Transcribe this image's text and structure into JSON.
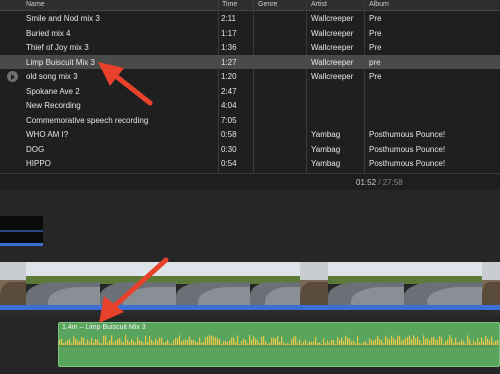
{
  "columns": {
    "name": "Name",
    "time": "Time",
    "genre": "Genre",
    "artist": "Artist",
    "album": "Album"
  },
  "songs": [
    {
      "name": "Smile and Nod mix 3",
      "time": "2:11",
      "artist": "Wallcreeper",
      "album": "Pre"
    },
    {
      "name": "Buried mix 4",
      "time": "1:17",
      "artist": "Wallcreeper",
      "album": "Pre"
    },
    {
      "name": "Thief of Joy mix 3",
      "time": "1:36",
      "artist": "Wallcreeper",
      "album": "Pre"
    },
    {
      "name": "Limp Buiscuit Mix 3",
      "time": "1:27",
      "artist": "Wallcreeper",
      "album": "pre"
    },
    {
      "name": "old song mix 3",
      "time": "1:20",
      "artist": "Wallcreeper",
      "album": "Pre"
    },
    {
      "name": "Spokane Ave 2",
      "time": "2:47",
      "artist": "",
      "album": ""
    },
    {
      "name": "New Recording",
      "time": "4:04",
      "artist": "",
      "album": ""
    },
    {
      "name": "Commemorative speech recording",
      "time": "7:05",
      "artist": "",
      "album": ""
    },
    {
      "name": "WHO AM I?",
      "time": "0:58",
      "artist": "Yambag",
      "album": "Posthumous Pounce!"
    },
    {
      "name": "DOG",
      "time": "0:30",
      "artist": "Yambag",
      "album": "Posthumous Pounce!"
    },
    {
      "name": "HIPPO",
      "time": "0:54",
      "artist": "Yambag",
      "album": "Posthumous Pounce!"
    }
  ],
  "selected_song_index": 3,
  "playing_song_index": 4,
  "player": {
    "current_time": "01:52",
    "separator": "/",
    "total_time": "27:58"
  },
  "timeline": {
    "music_clip_label": "1.4m – Limp Buiscuit Mix 3"
  },
  "colors": {
    "annotation_arrow": "#e8412c",
    "music_clip": "#5aa55e",
    "waveform": "#e8c64a",
    "audio_track": "#3c6fd6"
  },
  "icons": {
    "play": "play-icon"
  }
}
